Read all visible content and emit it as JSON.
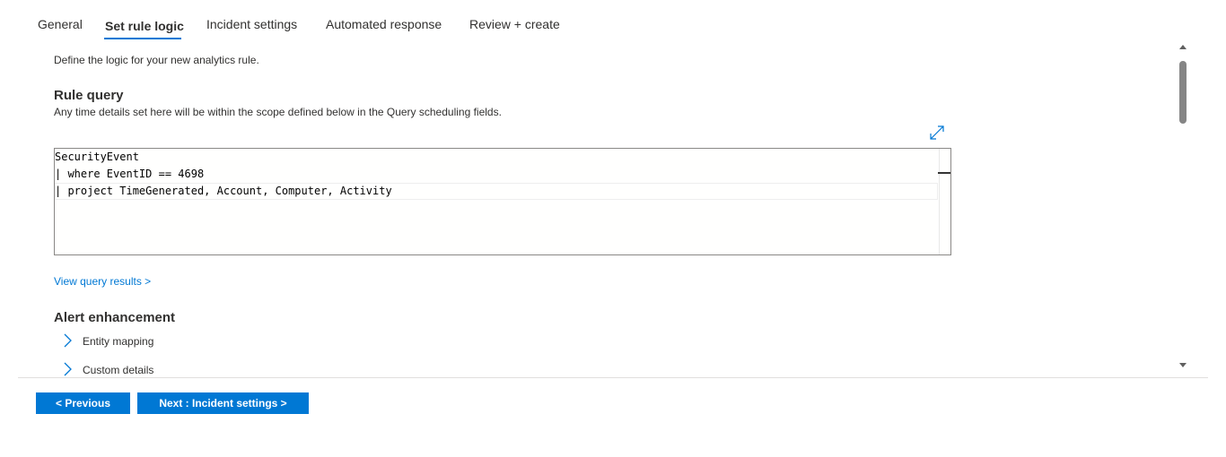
{
  "tabs": [
    {
      "label": "General",
      "active": false
    },
    {
      "label": "Set rule logic",
      "active": true
    },
    {
      "label": "Incident settings",
      "active": false
    },
    {
      "label": "Automated response",
      "active": false
    },
    {
      "label": "Review + create",
      "active": false
    }
  ],
  "intro": "Define the logic for your new analytics rule.",
  "rule_query": {
    "title": "Rule query",
    "description": "Any time details set here will be within the scope defined below in the Query scheduling fields.",
    "expand_icon": "expand-diagonal-icon",
    "lines": [
      "SecurityEvent",
      "| where EventID == 4698",
      "| project TimeGenerated, Account, Computer, Activity"
    ]
  },
  "view_results_link": "View query results >",
  "alert_enhancement": {
    "title": "Alert enhancement",
    "items": [
      {
        "label": "Entity mapping",
        "icon": "chevron-right-icon"
      },
      {
        "label": "Custom details",
        "icon": "chevron-right-icon"
      }
    ]
  },
  "buttons": {
    "previous": "< Previous",
    "next": "Next : Incident settings >"
  },
  "colors": {
    "accent": "#0078d4",
    "text": "#323130"
  }
}
